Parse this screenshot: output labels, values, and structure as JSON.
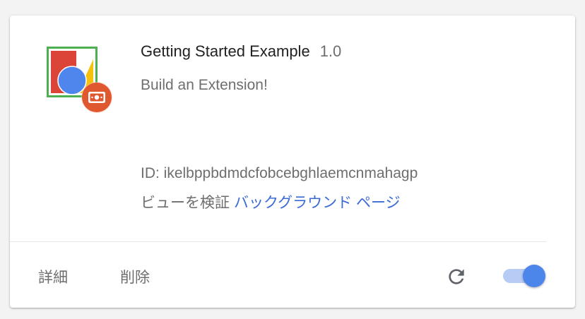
{
  "extension": {
    "name": "Getting Started Example",
    "version": "1.0",
    "description": "Build an Extension!",
    "id_text": "ID: ikelbppbdmdcfobcebghlaemcnmahagp",
    "inspect_views_label": "ビューを検証",
    "inspect_link": "バックグラウンド ページ",
    "icon": "extension-shapes-icon",
    "badge_icon": "unpacked-badge-icon"
  },
  "footer": {
    "details_label": "詳細",
    "remove_label": "削除",
    "reload_icon": "reload-icon",
    "enabled": true
  },
  "colors": {
    "link": "#3b6bd6",
    "toggle_on": "#4d86eb",
    "toggle_track": "#b7ccf4",
    "badge": "#e0582f"
  }
}
